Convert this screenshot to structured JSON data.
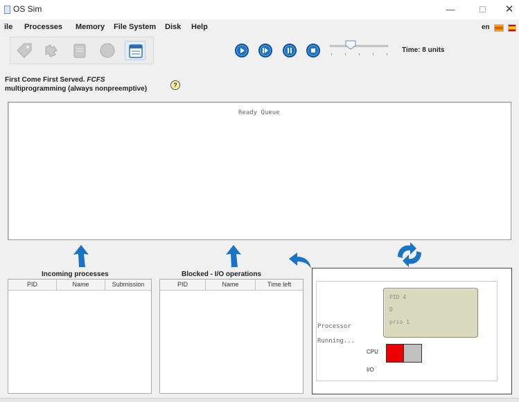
{
  "window": {
    "title": "OS Sim",
    "minimize": "—",
    "close": "✕"
  },
  "menu": {
    "items": [
      "ile",
      "Processes",
      "Memory",
      "File System",
      "Disk",
      "Help"
    ],
    "language": "en"
  },
  "toolbar": {
    "icons": [
      "tag-icon",
      "puzzle-icon",
      "document-icon",
      "disk-icon",
      "calendar-icon"
    ],
    "controls": [
      "play-icon",
      "step-icon",
      "pause-icon",
      "stop-icon"
    ],
    "time_label": "Time: 8 units"
  },
  "algorithm": {
    "name": "First Come First Served.",
    "abbr": "FCFS",
    "mode": "multiprogramming (always nonpreemptive)",
    "help": "?"
  },
  "ready_queue": {
    "title": "Ready Queue"
  },
  "incoming": {
    "label": "Incoming processes",
    "columns": [
      "PID",
      "Name",
      "Submission"
    ]
  },
  "blocked": {
    "label": "Blocked - I/O operations",
    "columns": [
      "PID",
      "Name",
      "Time left"
    ]
  },
  "processor": {
    "label": "Processor",
    "status": "Running...",
    "pid_lines": [
      "PID 4",
      "D",
      "prio 1"
    ],
    "cpu_label": "CPU",
    "io_label": "I/O"
  },
  "colors": {
    "accent": "#1a74c6",
    "cpu_active": "#ee0000",
    "cpu_idle": "#c0c0c0",
    "pid_box": "#d9d9be"
  }
}
